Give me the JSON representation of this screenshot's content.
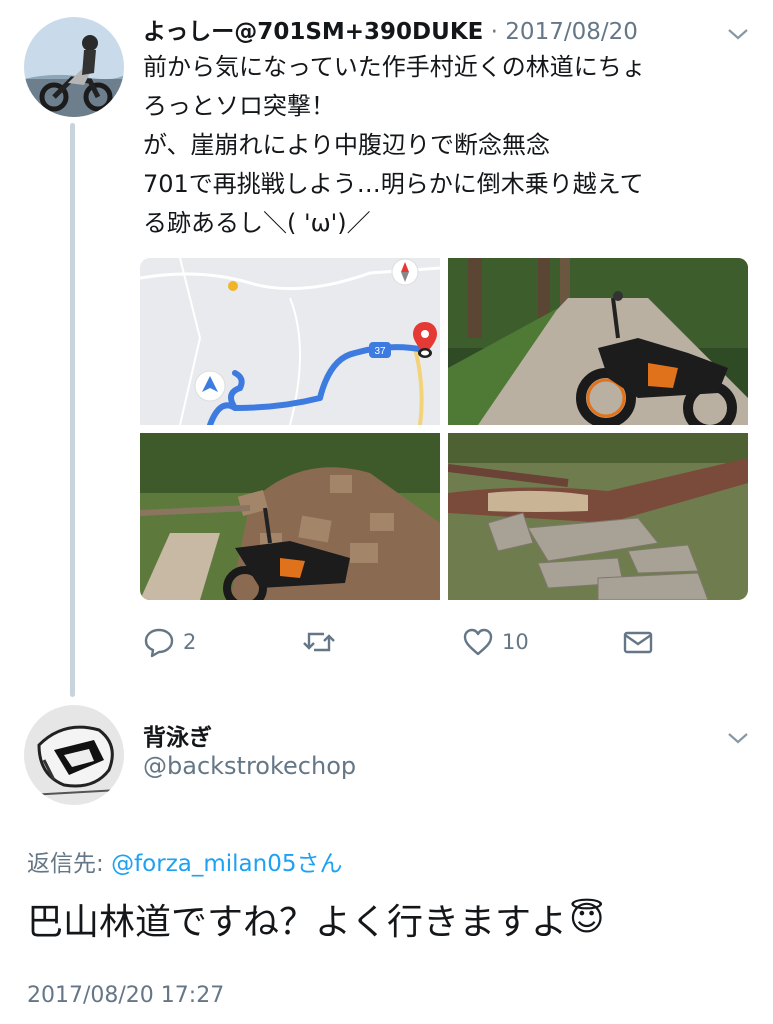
{
  "tweet": {
    "name": "よっしー@701SM+390DUKE",
    "separator": "·",
    "date": "2017/08/20",
    "text": "前から気になっていた作手村近くの林道にちょ\nろっとソロ突撃！\nが、崖崩れにより中腹辺りで断念無念\n701で再挑戦しよう…明らかに倒木乗り越えて\nる跡あるし＼( 'ω')／",
    "map_route_label": "37",
    "reply_count": "2",
    "retweet_count": "",
    "like_count": "10"
  },
  "reply": {
    "name": "背泳ぎ",
    "handle": "@backstrokechop",
    "reply_to_prefix": "返信先: ",
    "reply_to_handle": "@forza_milan05さん",
    "text": "巴山林道ですね？よく行きますよ",
    "emoji": "😇",
    "timestamp": "2017/08/20 17:27"
  },
  "colors": {
    "text": "#14171a",
    "muted": "#657786",
    "link": "#1da1f2",
    "thread_line": "#c8d3dc",
    "map_route": "#3d7be0"
  }
}
